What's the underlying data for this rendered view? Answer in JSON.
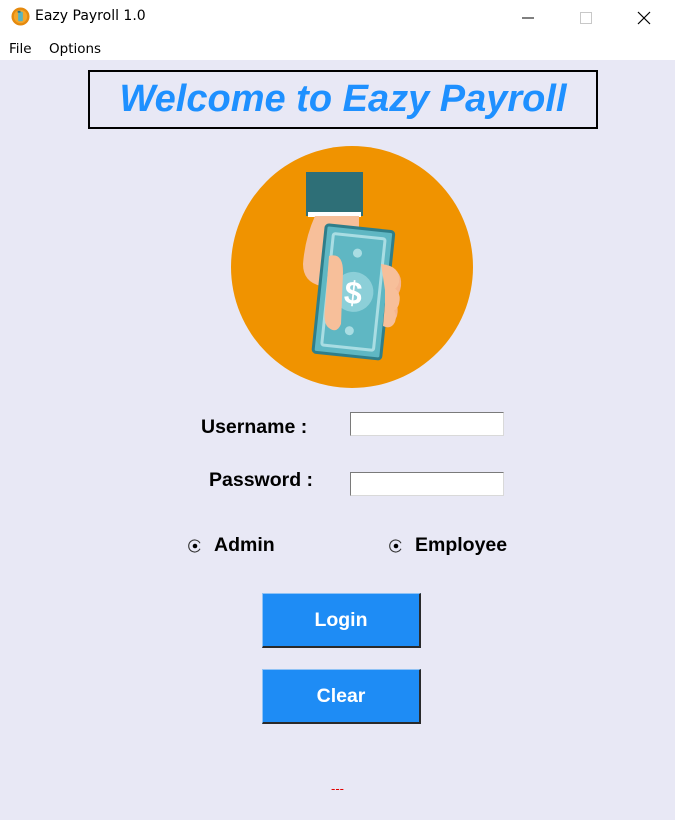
{
  "window": {
    "title": "Eazy Payroll 1.0",
    "icon": "coin-icon",
    "controls": [
      "minimize-icon",
      "maximize-icon",
      "close-icon"
    ]
  },
  "menu": {
    "items": [
      {
        "label": "File"
      },
      {
        "label": "Options"
      }
    ]
  },
  "banner": {
    "title": "Welcome to Eazy Payroll",
    "color": "#1e90ff"
  },
  "logo": {
    "icon": "hand-holding-money-icon",
    "circle_color": "#f09300",
    "cash_color": "#5bb4c0"
  },
  "form": {
    "username_label": "Username :",
    "username_value": "",
    "password_label": "Password :",
    "password_value": "",
    "roles": [
      {
        "label": "Admin"
      },
      {
        "label": "Employee"
      }
    ]
  },
  "buttons": {
    "login_label": "Login",
    "clear_label": "Clear",
    "color": "#1e8cf5"
  },
  "status": {
    "text": "---",
    "color": "#e00000"
  },
  "colors": {
    "background": "#e8e8f5"
  }
}
